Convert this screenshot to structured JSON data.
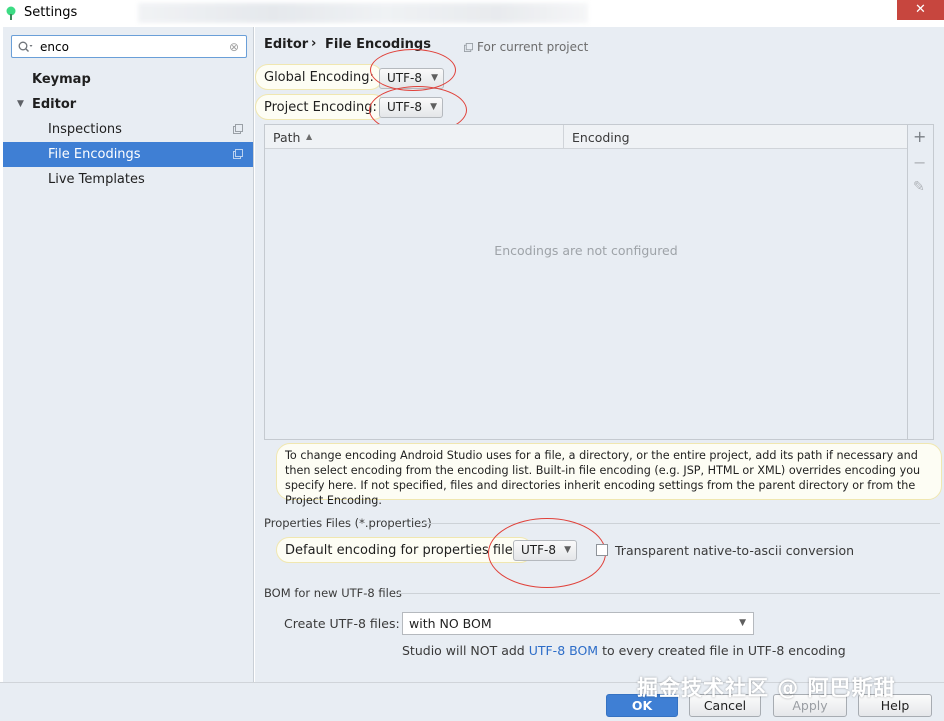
{
  "window": {
    "title": "Settings",
    "close_symbol": "✕"
  },
  "sidebar": {
    "search_value": "enco",
    "clear_symbol": "⊗",
    "items": [
      {
        "label": "Keymap"
      },
      {
        "label": "Editor"
      },
      {
        "label": "Inspections"
      },
      {
        "label": "File Encodings"
      },
      {
        "label": "Live Templates"
      }
    ]
  },
  "breadcrumb": {
    "parent": "Editor",
    "separator": "›",
    "current": "File Encodings",
    "scope_note": "For current project"
  },
  "encoding": {
    "global_label": "Global Encoding:",
    "global_value": "UTF-8",
    "project_label": "Project Encoding:",
    "project_value": "UTF-8"
  },
  "table": {
    "col_path": "Path",
    "col_encoding": "Encoding",
    "sort_symbol": "▲",
    "empty_text": "Encodings are not configured",
    "tools": {
      "add": "+",
      "remove": "−",
      "edit": "✎"
    }
  },
  "hint_text": "To change encoding Android Studio uses for a file, a directory, or the entire project, add its path if necessary and then select encoding from the encoding list. Built-in file encoding (e.g. JSP, HTML or XML) overrides encoding you specify here. If not specified, files and directories inherit encoding settings from the parent directory or from the Project Encoding.",
  "properties": {
    "section_title": "Properties Files (*.properties)",
    "default_label": "Default encoding for properties files:",
    "default_value": "UTF-8",
    "transparent_label": "Transparent native-to-ascii conversion",
    "transparent_checked": false
  },
  "bom": {
    "section_title": "BOM for new UTF-8 files",
    "create_label": "Create UTF-8 files:",
    "create_value": "with NO BOM",
    "note_prefix": "Studio will NOT add ",
    "note_link": "UTF-8 BOM",
    "note_suffix": " to every created file in UTF-8 encoding"
  },
  "buttons": {
    "ok": "OK",
    "cancel": "Cancel",
    "apply": "Apply",
    "help": "Help"
  },
  "watermark": "掘金技术社区 @ 阿巴斯甜",
  "colors": {
    "accent": "#3f7fd4",
    "annotation_red": "#e0413a",
    "highlight_bg": "#fdfdf4",
    "link": "#2d6dc8"
  }
}
